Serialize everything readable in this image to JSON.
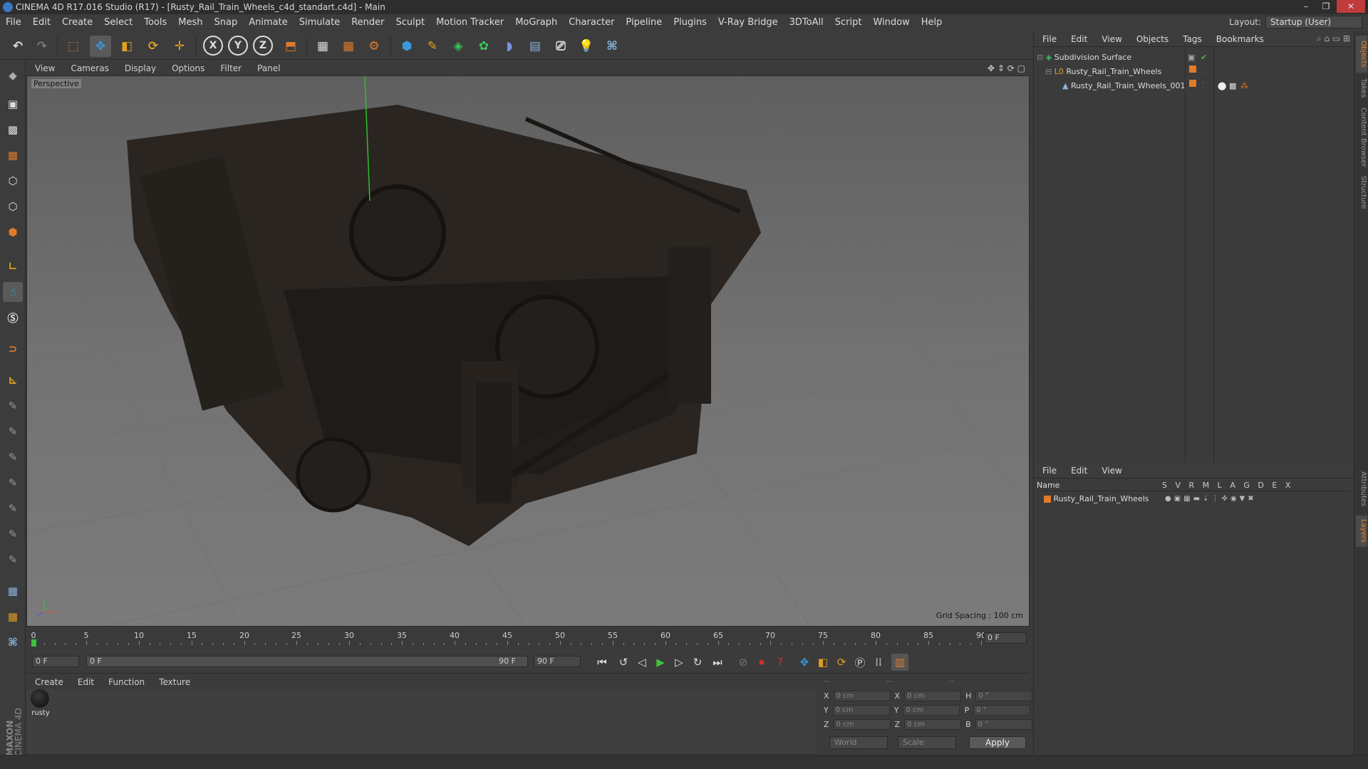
{
  "window": {
    "title": "CINEMA 4D R17.016 Studio (R17) - [Rusty_Rail_Train_Wheels_c4d_standart.c4d] - Main"
  },
  "menubar": {
    "items": [
      "File",
      "Edit",
      "Create",
      "Select",
      "Tools",
      "Mesh",
      "Snap",
      "Animate",
      "Simulate",
      "Render",
      "Sculpt",
      "Motion Tracker",
      "MoGraph",
      "Character",
      "Pipeline",
      "Plugins",
      "V-Ray Bridge",
      "3DToAll",
      "Script",
      "Window",
      "Help"
    ],
    "layout_label": "Layout:",
    "layout_value": "Startup (User)"
  },
  "toolbar": {
    "axis_x": "X",
    "axis_y": "Y",
    "axis_z": "Z"
  },
  "viewport": {
    "menu": [
      "View",
      "Cameras",
      "Display",
      "Options",
      "Filter",
      "Panel"
    ],
    "label": "Perspective",
    "grid_spacing": "Grid Spacing : 100 cm"
  },
  "timeline": {
    "ticks": [
      "0",
      "5",
      "10",
      "15",
      "20",
      "25",
      "30",
      "35",
      "40",
      "45",
      "50",
      "55",
      "60",
      "65",
      "70",
      "75",
      "80",
      "85",
      "90"
    ],
    "current_frame": "0 F",
    "start_field": "0 F",
    "range_start": "0 F",
    "range_end": "90 F",
    "end_field": "90 F"
  },
  "material_manager": {
    "menu": [
      "Create",
      "Edit",
      "Function",
      "Texture"
    ],
    "materials": [
      {
        "name": "rusty"
      }
    ]
  },
  "coordinates": {
    "header": [
      "--",
      "--",
      "--"
    ],
    "rows": [
      {
        "pos_label": "X",
        "pos": "0 cm",
        "size_label": "X",
        "size": "0 cm",
        "rot_label": "H",
        "rot": "0 °"
      },
      {
        "pos_label": "Y",
        "pos": "0 cm",
        "size_label": "Y",
        "size": "0 cm",
        "rot_label": "P",
        "rot": "0 °"
      },
      {
        "pos_label": "Z",
        "pos": "0 cm",
        "size_label": "Z",
        "size": "0 cm",
        "rot_label": "B",
        "rot": "0 °"
      }
    ],
    "mode": "World",
    "transform": "Scale",
    "apply": "Apply"
  },
  "object_manager": {
    "menu": [
      "File",
      "Edit",
      "View",
      "Objects",
      "Tags",
      "Bookmarks"
    ],
    "objects": [
      {
        "name": "Subdivision Surface"
      },
      {
        "name": "Rusty_Rail_Train_Wheels"
      },
      {
        "name": "Rusty_Rail_Train_Wheels_001"
      }
    ]
  },
  "layer_manager": {
    "menu": [
      "File",
      "Edit",
      "View"
    ],
    "col_name": "Name",
    "columns": [
      "S",
      "V",
      "R",
      "M",
      "L",
      "A",
      "G",
      "D",
      "E",
      "X"
    ],
    "layers": [
      {
        "name": "Rusty_Rail_Train_Wheels",
        "color": "#e07b2a"
      }
    ]
  },
  "side_tabs": [
    "Objects",
    "Takes",
    "Content Browser",
    "Structure",
    "Attributes",
    "Layers"
  ],
  "branding": {
    "line1": "MAXON",
    "line2": "CINEMA 4D"
  },
  "colors": {
    "accent": "#e07b2a",
    "selection": "#5a5a5a",
    "close": "#c03b3b"
  }
}
